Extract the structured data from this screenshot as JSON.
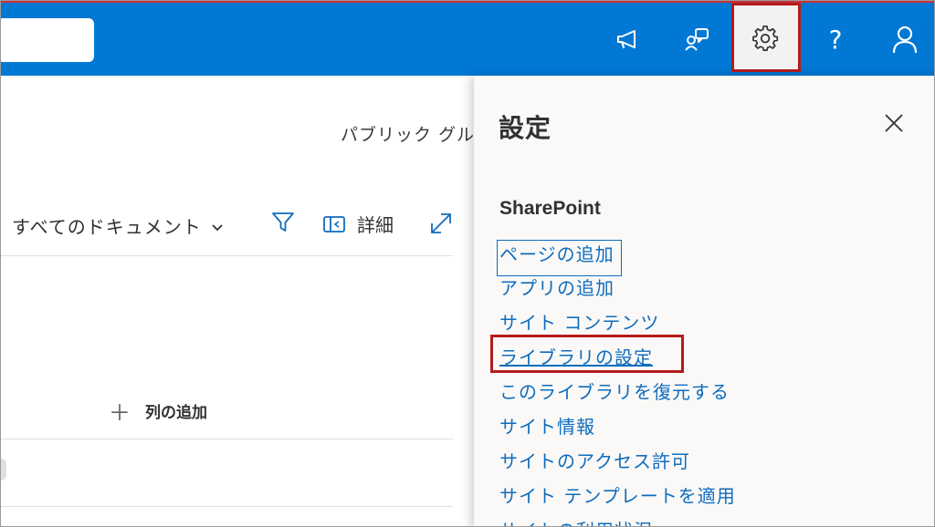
{
  "header": {
    "icons": [
      "megaphone-icon",
      "people-switch-icon",
      "gear-icon",
      "help-icon",
      "person-icon"
    ],
    "help_label": "?"
  },
  "main": {
    "group_label": "パブリック グル",
    "view_label": "すべてのドキュメント",
    "details_label": "詳細",
    "add_column_label": "列の追加",
    "add_column_plus": "＋"
  },
  "settings": {
    "title": "設定",
    "section": "SharePoint",
    "links": [
      "ページの追加",
      "アプリの追加",
      "サイト コンテンツ",
      "ライブラリの設定",
      "このライブラリを復元する",
      "サイト情報",
      "サイトのアクセス許可",
      "サイト テンプレートを適用",
      "サイトの利用状況"
    ],
    "highlighted_link": "ライブラリの設定"
  },
  "colors": {
    "brand": "#0078d4",
    "link": "#0f6cbd",
    "highlight": "#b51b1b"
  }
}
